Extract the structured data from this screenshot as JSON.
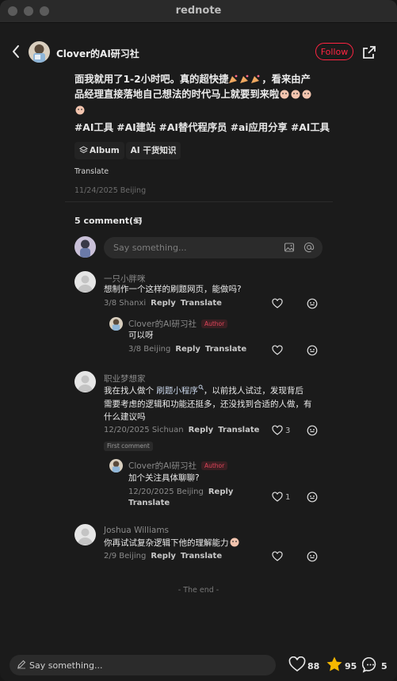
{
  "window": {
    "title": "rednote"
  },
  "header": {
    "author": "Clover的AI研习社",
    "follow": "Follow"
  },
  "post": {
    "lines": [
      "面我就用了1-2小时吧。真的超快捷",
      "，看来由产",
      "品经理直接落地自己想法的时代马上就要到来啦"
    ],
    "tags": "#AI工具 #AI建站 #AI替代程序员 #ai应用分享 #AI工具",
    "album_label": "Album",
    "album_name": "AI 干货知识",
    "translate": "Translate",
    "date": "11/24/2025 Beijing"
  },
  "comments_header": {
    "count_label": "5 comment(s)",
    "placeholder": "Say something..."
  },
  "comments": [
    {
      "user": "一只小胖咪",
      "text": "想制作一个这样的刷题网页，能做吗?",
      "meta": "3/8 Shanxi",
      "reply": "Reply",
      "translate": "Translate",
      "likes": "",
      "reply_item": {
        "user": "Clover的AI研习社",
        "tag": "Author",
        "text": "可以呀",
        "meta": "3/8 Beijing",
        "reply": "Reply",
        "translate": "Translate",
        "likes": ""
      }
    },
    {
      "user": "职业梦想家",
      "text_pre": "我在找人做个 ",
      "text_link": "刷题小程序",
      "text_post_1": "，以前找人试过，发现背后",
      "text_line2": "需要考虑的逻辑和功能还挺多，还没找到合适的人做，有",
      "text_line3": "什么建议吗",
      "meta": "12/20/2025 Sichuan",
      "reply": "Reply",
      "translate": "Translate",
      "likes": "3",
      "badge": "First comment",
      "reply_item": {
        "user": "Clover的AI研习社",
        "tag": "Author",
        "text": "加个关注具体聊聊?",
        "meta": "12/20/2025 Beijing",
        "reply": "Reply",
        "translate": "Translate",
        "likes": "1"
      }
    },
    {
      "user": "Joshua Williams",
      "text": "你再试试复杂逻辑下他的理解能力",
      "meta": "2/9 Beijing",
      "reply": "Reply",
      "translate": "Translate",
      "likes": ""
    }
  ],
  "end_text": "- The end -",
  "bottom": {
    "placeholder": "Say something...",
    "likes": "88",
    "stars": "95",
    "comments": "5"
  },
  "colors": {
    "accent": "#ff2442",
    "star": "#f5b700",
    "background": "#1b1b1b"
  }
}
